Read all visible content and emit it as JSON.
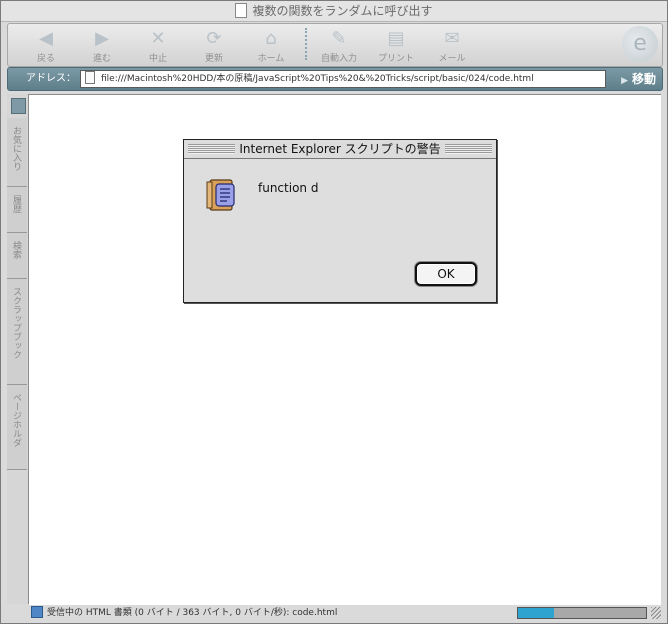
{
  "window": {
    "title": "複数の関数をランダムに呼び出す"
  },
  "toolbar": {
    "buttons": [
      {
        "label": "戻る",
        "icon": "back-arrow-icon",
        "glyph": "◀"
      },
      {
        "label": "進む",
        "icon": "forward-arrow-icon",
        "glyph": "▶"
      },
      {
        "label": "中止",
        "icon": "stop-x-icon",
        "glyph": "✕"
      },
      {
        "label": "更新",
        "icon": "refresh-icon",
        "glyph": "⟳"
      },
      {
        "label": "ホーム",
        "icon": "home-icon",
        "glyph": "⌂"
      },
      {
        "label": "自動入力",
        "icon": "autofill-pen-icon",
        "glyph": "✎"
      },
      {
        "label": "プリント",
        "icon": "printer-icon",
        "glyph": "▤"
      },
      {
        "label": "メール",
        "icon": "mail-icon",
        "glyph": "✉"
      }
    ]
  },
  "address": {
    "label": "アドレス：",
    "url": "file:///Macintosh%20HDD/本の原稿/JavaScript%20Tips%20&%20Tricks/script/basic/024/code.html",
    "go_label": "移動"
  },
  "sidebar": {
    "tabs": [
      "お気に入り",
      "履歴",
      "検索",
      "スクラップブック",
      "ページホルダ"
    ]
  },
  "dialog": {
    "title": "Internet Explorer スクリプトの警告",
    "message": "function d",
    "ok_label": "OK"
  },
  "status": {
    "text": "受信中の HTML 書類 (0 バイト / 363 バイト, 0 バイト/秒): code.html",
    "progress": 0.28
  },
  "colors": {
    "accent": "#6a8c98",
    "progress": "#2fa3cf"
  }
}
